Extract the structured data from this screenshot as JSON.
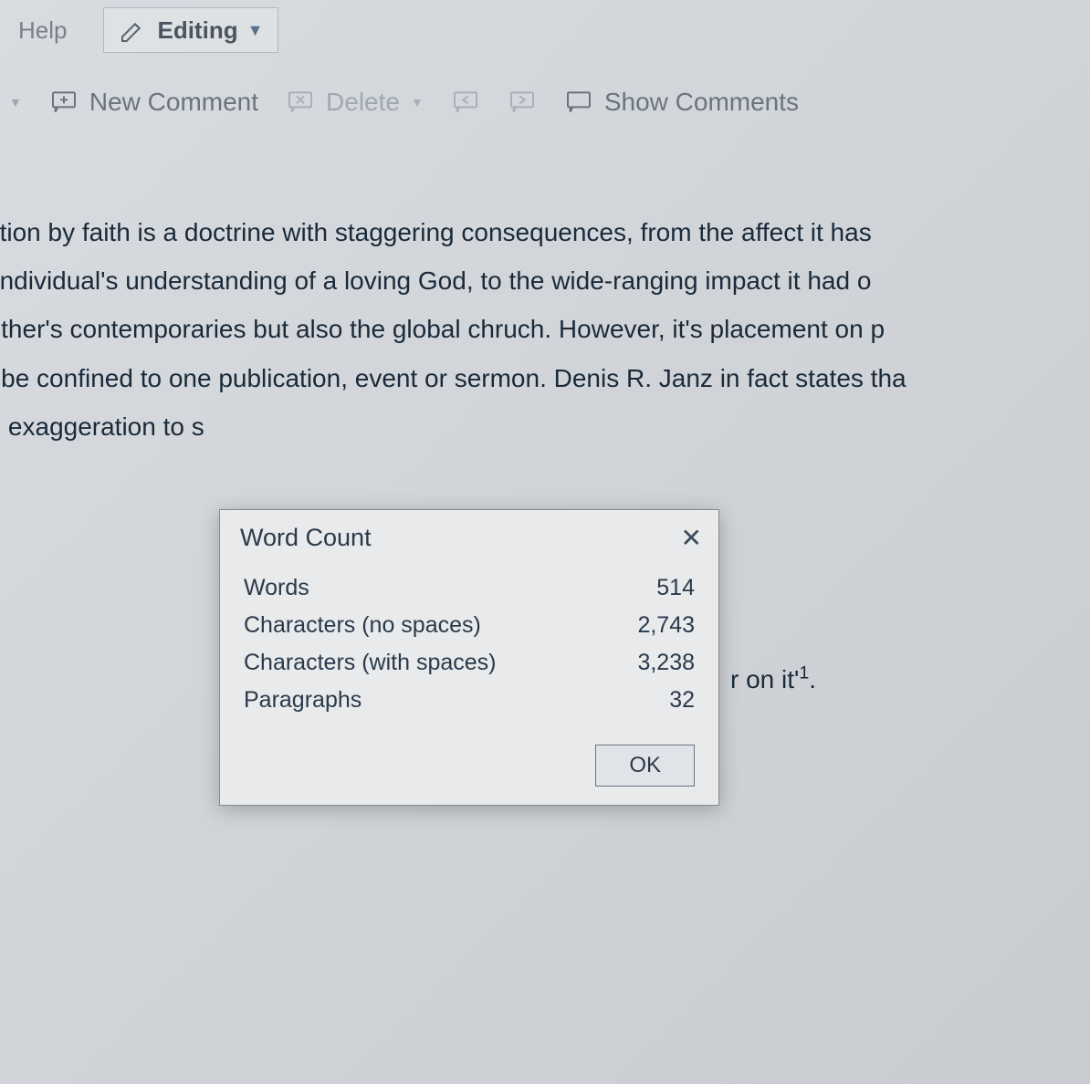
{
  "menu": {
    "help": "Help",
    "editing": "Editing"
  },
  "toolbar": {
    "new_comment": "New Comment",
    "delete": "Delete",
    "show_comments": "Show Comments"
  },
  "document": {
    "line1": "cation by faith is a doctrine with staggering consequences, from the affect it has",
    "line2": "e individual's understanding of a loving God, to the wide-ranging impact it had o",
    "line3": "Luther's contemporaries but also the global chruch. However, it's placement on p",
    "line4": "ot be confined to one publication, event or sermon. Denis R. Janz in fact states tha",
    "line5": "an exaggeration to s",
    "after_dialog_text": "r on it'",
    "footnote": "1",
    "period": "."
  },
  "dialog": {
    "title": "Word Count",
    "rows": [
      {
        "label": "Words",
        "value": "514"
      },
      {
        "label": "Characters (no spaces)",
        "value": "2,743"
      },
      {
        "label": "Characters (with spaces)",
        "value": "3,238"
      },
      {
        "label": "Paragraphs",
        "value": "32"
      }
    ],
    "ok": "OK"
  }
}
